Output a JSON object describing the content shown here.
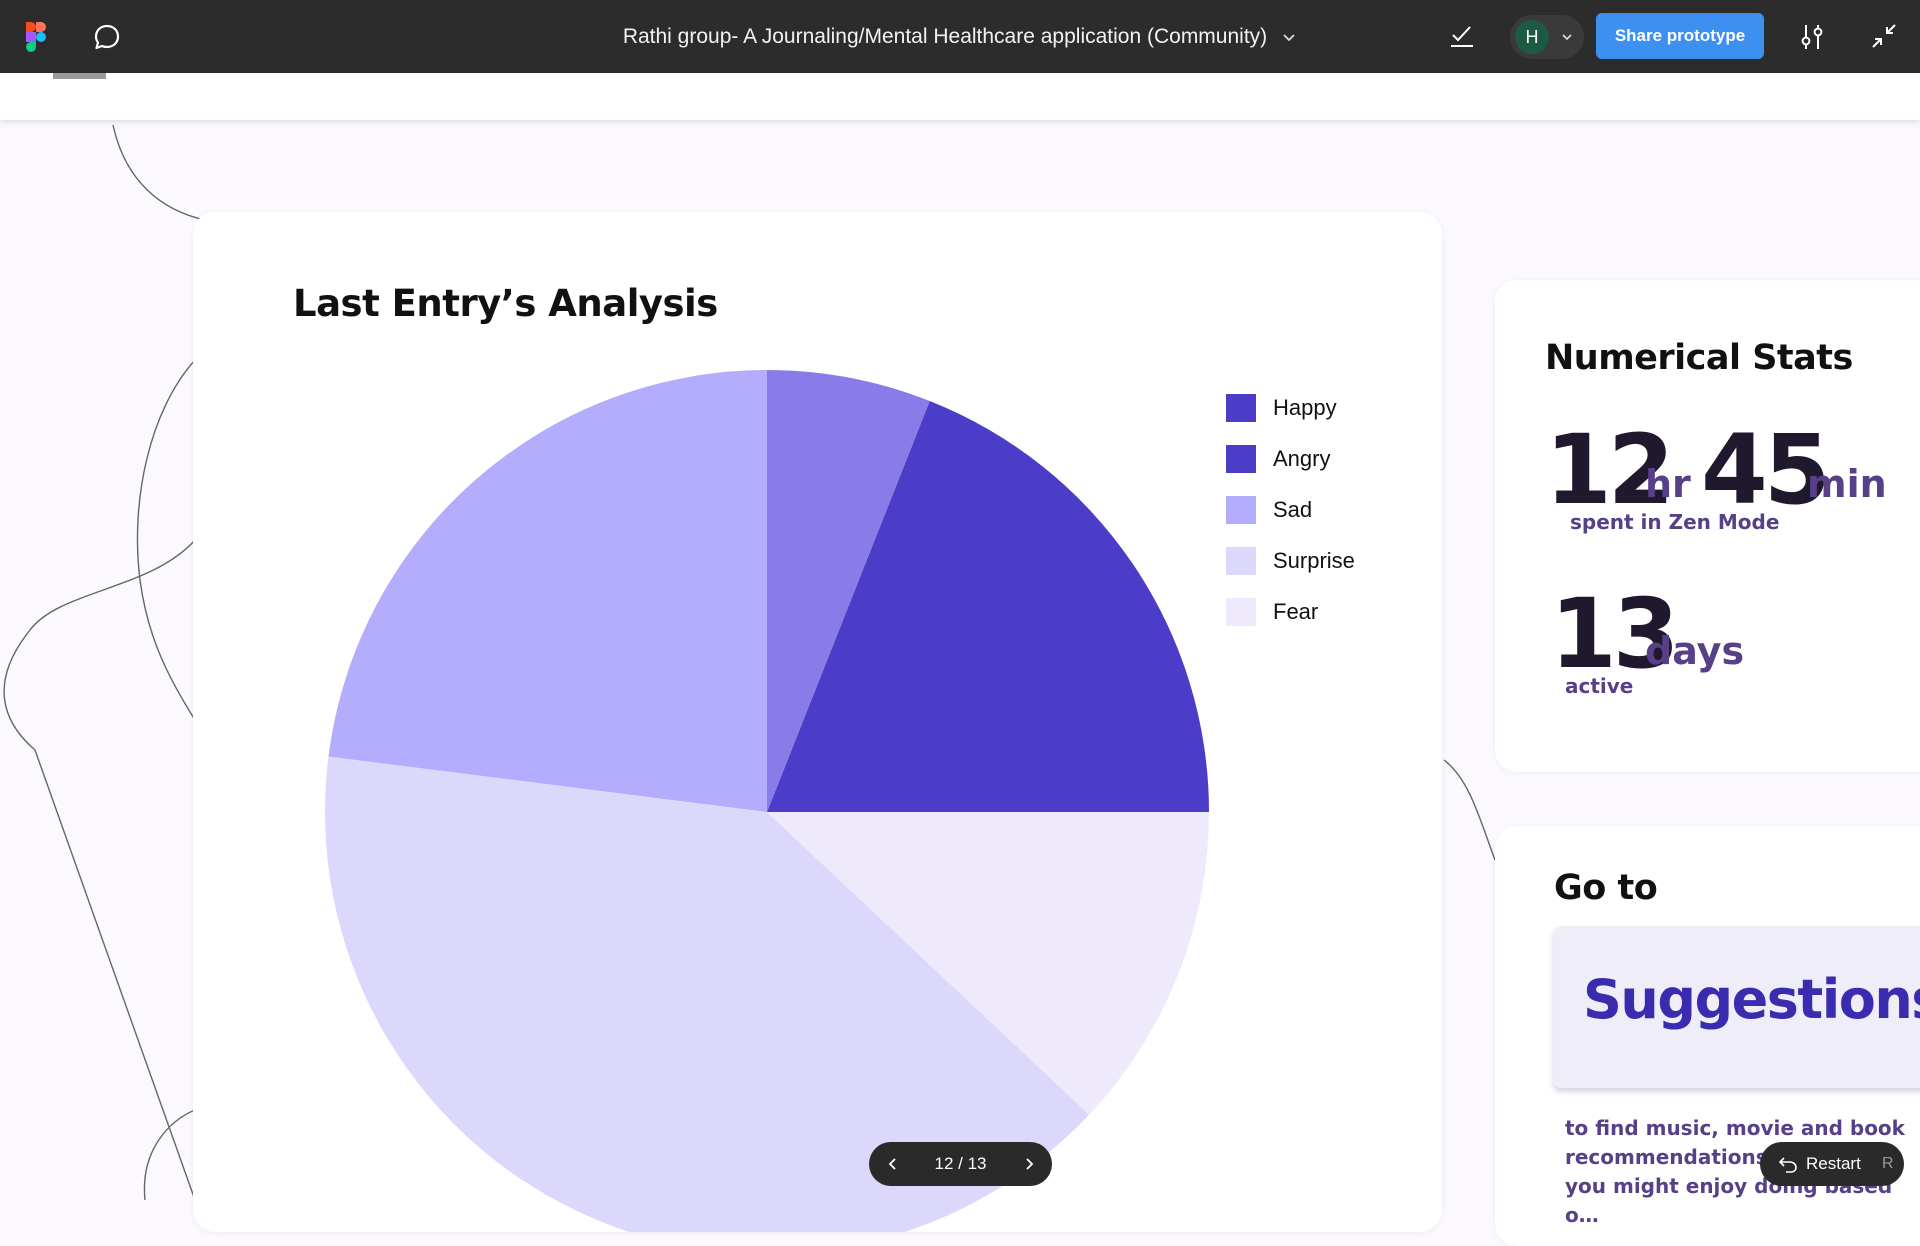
{
  "topbar": {
    "logo_icon": "figma-logo",
    "comment_icon": "speech-bubble-icon",
    "file_title": "Rathi group- A Journaling/Mental Healthcare application (Community)",
    "title_chevron_icon": "chevron-down-icon",
    "check_icon": "checkmark-icon",
    "avatar_initial": "H",
    "avatar_color": "#1d5a44",
    "share_label": "Share prototype",
    "share_color": "#3d8ff0",
    "settings_icon": "sliders-icon",
    "collapse_icon": "collapse-arrows-icon"
  },
  "analysis_card": {
    "title": "Last Entry’s Analysis"
  },
  "chart_data": {
    "type": "pie",
    "categories": [
      "Happy",
      "Angry",
      "Sad",
      "Surprise",
      "Fear"
    ],
    "values": [
      19,
      6,
      23,
      40,
      12
    ],
    "colors": [
      "#4c3dc8",
      "#897be8",
      "#b4acfc",
      "#dcd8fc",
      "#eeeafc"
    ],
    "legend": {
      "position": "right",
      "entries": [
        {
          "label": "Happy",
          "color": "#4c3dc8"
        },
        {
          "label": "Angry",
          "color": "#4c3dc8"
        },
        {
          "label": "Sad",
          "color": "#b4acfc"
        },
        {
          "label": "Surprise",
          "color": "#dcd8fc"
        },
        {
          "label": "Fear",
          "color": "#eeeafc"
        }
      ]
    }
  },
  "stats": {
    "title": "Numerical Stats",
    "hours": "12",
    "hours_unit": "hr",
    "minutes": "45",
    "minutes_unit": "min",
    "zen_label": "spent in Zen Mode",
    "days": "13",
    "days_unit": "days",
    "days_label": "active"
  },
  "goto": {
    "title": "Go to",
    "button_label": "Suggestions",
    "description": "to find music, movie and book recommendations al… things you might enjoy doing based o…"
  },
  "pager": {
    "text": "12 / 13",
    "prev_icon": "chevron-left-icon",
    "next_icon": "chevron-right-icon"
  },
  "restart": {
    "label": "Restart",
    "shortcut": "R",
    "icon": "undo-arrow-icon"
  },
  "colors": {
    "topbar_bg": "#2c2c2c",
    "canvas_bg": "#fbf9fd",
    "accent_purple": "#574088"
  }
}
